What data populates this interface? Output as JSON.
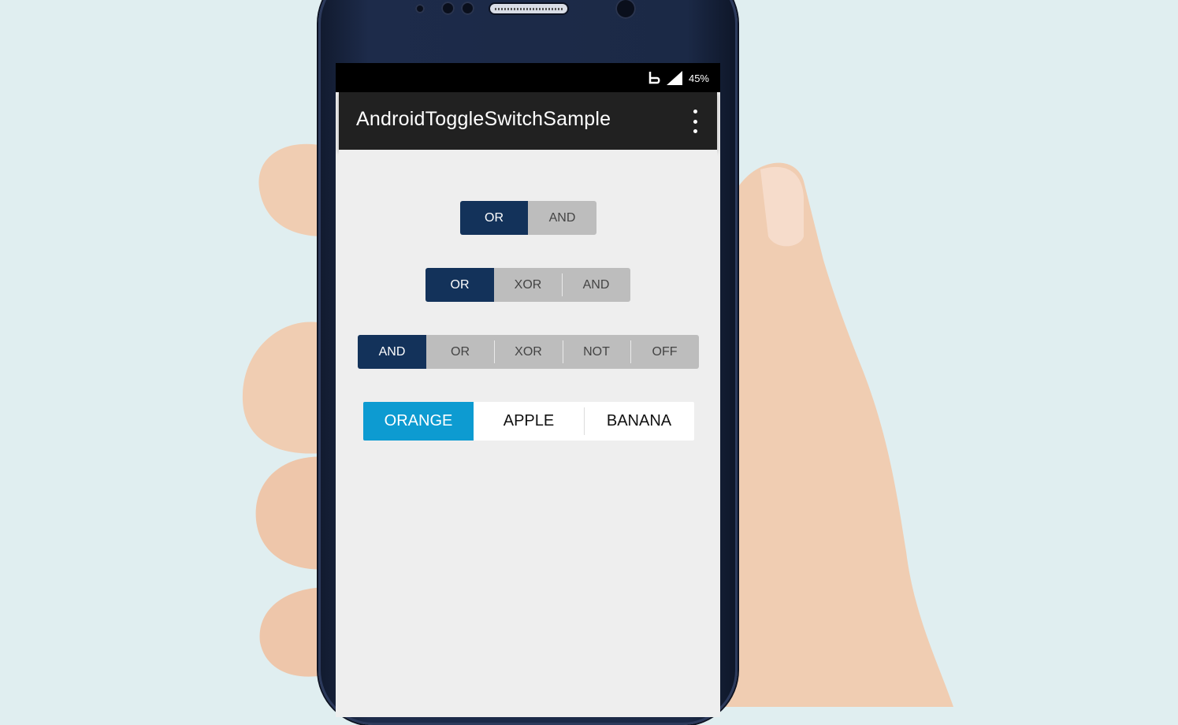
{
  "status_bar": {
    "battery": "45%"
  },
  "app_bar": {
    "title": "AndroidToggleSwitchSample",
    "menu_icon": "overflow-menu-icon"
  },
  "toggles": [
    {
      "options": [
        "OR",
        "AND"
      ],
      "selected": "OR"
    },
    {
      "options": [
        "OR",
        "XOR",
        "AND"
      ],
      "selected": "OR"
    },
    {
      "options": [
        "AND",
        "OR",
        "XOR",
        "NOT",
        "OFF"
      ],
      "selected": "AND"
    },
    {
      "options": [
        "ORANGE",
        "APPLE",
        "BANANA"
      ],
      "selected": "ORANGE"
    }
  ],
  "colors": {
    "background": "#e0eef0",
    "app_bar": "#212121",
    "active_dark": "#13325a",
    "inactive": "#bdbdbd",
    "active_blue": "#0d9bd1"
  }
}
